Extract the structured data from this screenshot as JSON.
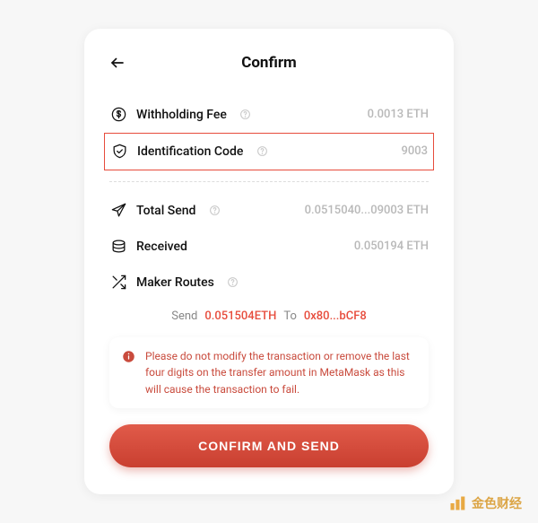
{
  "header": {
    "title": "Confirm"
  },
  "rows": {
    "withholding": {
      "label": "Withholding Fee",
      "value": "0.0013 ETH"
    },
    "identification": {
      "label": "Identification Code",
      "value": "9003"
    },
    "totalSend": {
      "label": "Total Send",
      "value": "0.0515040...09003 ETH"
    },
    "received": {
      "label": "Received",
      "value": "0.050194 ETH"
    },
    "makerRoutes": {
      "label": "Maker Routes"
    }
  },
  "makerRoute": {
    "sendLabel": "Send",
    "sendValue": "0.051504ETH",
    "toLabel": "To",
    "toValue": "0x80...bCF8"
  },
  "warning": {
    "text": "Please do not modify the transaction or remove the last four digits on the transfer amount in MetaMask as this will cause the transaction to fail."
  },
  "confirmButton": {
    "label": "CONFIRM AND SEND"
  },
  "watermark": {
    "text": "金色财经"
  }
}
